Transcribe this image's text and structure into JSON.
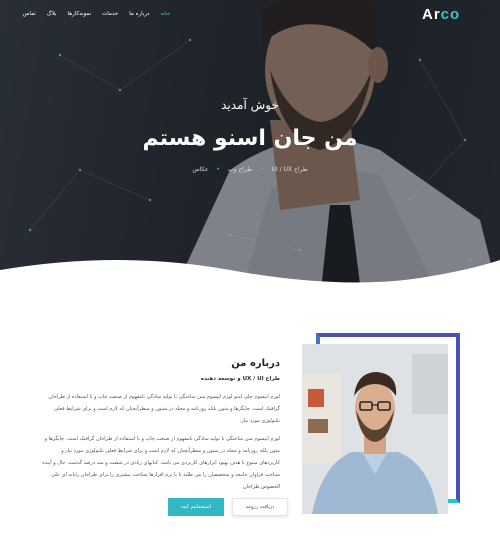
{
  "nav": {
    "logo_main": "Ar",
    "logo_accent": "co",
    "menu": [
      "خانه",
      "درباره ما",
      "خدمات",
      "نمونه‌کارها",
      "بلاگ",
      "تماس"
    ]
  },
  "hero": {
    "welcome": "خوش آمدید",
    "title": "من جان اسنو هستم",
    "tags": [
      "طراح UI / UX",
      "طراح وب",
      "عکاس"
    ]
  },
  "about": {
    "title": "درباره من",
    "subtitle": "طراح UX / UI و توسعه دهنده",
    "para1": "لورم ایپسوم چلی امنو لورم ایپسوم متن ساختگی با تولید سادگی نامفهوم از صنعت چاپ و با استفاده از طراحان گرافیک است. چاپگرها و متون بلکه روزنامه و مجله در ستون و سطرآنچنان که لازم است و برای شرایط فعلی تکنولوژی مورد نیاز.",
    "para2": "لورم ایپسوم متن ساختگی با تولید سادگی نامفهوم از صنعت چاپ و با استفاده از طراحان گرافیک است. چاپگرها و متون بلکه روزنامه و مجله در ستون و سطرآنچنان که لازم است و برای شرایط فعلی تکنولوژی مورد نیاز و کاربردهای متنوع با هدف بهبود ابزارهای کاربردی می باشد. کتابهای زیادی در شصت و سه درصد گذشته، حال و آینده شناخت فراوان جامعه و متخصصان را می طلبد تا با نرم افزارها شناخت بیشتری را برای طراحان رایانه ای علی الخصوص طراحان",
    "btn_hire": "استخدامم کنید",
    "btn_resume": "دریافت رزومه"
  },
  "colors": {
    "accent": "#33b7c3",
    "frame_top": "#4a52b8",
    "frame_bottom": "#29c3cf"
  }
}
